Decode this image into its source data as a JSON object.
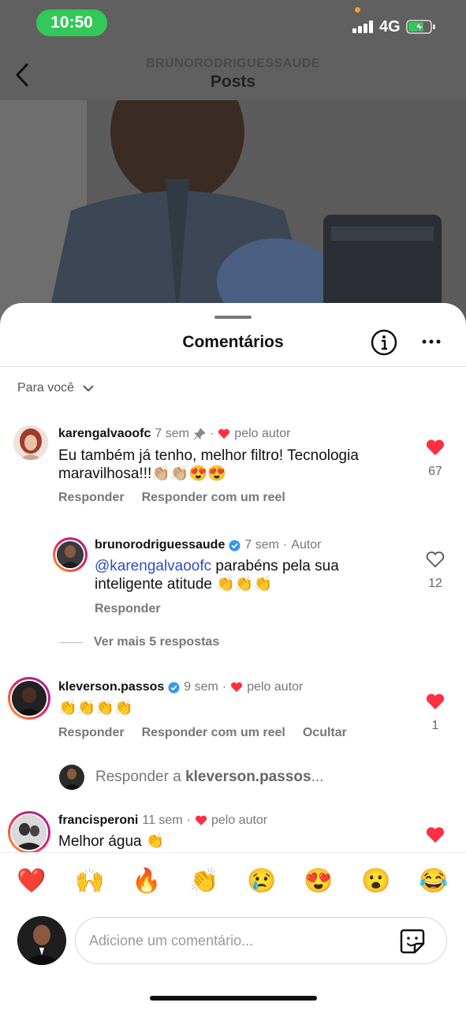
{
  "status": {
    "time": "10:50",
    "network": "4G"
  },
  "header": {
    "username": "BRUNORODRIGUESSAUDE",
    "title": "Posts"
  },
  "sheet": {
    "title": "Comentários",
    "sort_label": "Para você"
  },
  "comments": [
    {
      "username": "karengalvaoofc",
      "time": "7 sem",
      "liked_by_author": "pelo autor",
      "text": "Eu também já tenho, melhor filtro! Tecnologia maravilhosa!!!👏🏼👏🏼😍😍",
      "likes": "67",
      "actions": [
        "Responder",
        "Responder com um reel"
      ]
    },
    {
      "username": "brunorodriguessaude",
      "time": "7 sem",
      "author_badge": "Autor",
      "mention": "@karengalvaoofc",
      "text": " parabéns pela sua inteligente atitude 👏👏👏",
      "likes": "12",
      "actions": [
        "Responder"
      ]
    },
    {
      "username": "kleverson.passos",
      "time": "9 sem",
      "liked_by_author": "pelo autor",
      "text": "👏👏👏👏",
      "likes": "1",
      "actions": [
        "Responder",
        "Responder com um reel",
        "Ocultar"
      ]
    },
    {
      "username": "francisperoni",
      "time": "11 sem",
      "liked_by_author": "pelo autor",
      "text": "Melhor água 👏"
    }
  ],
  "more_replies": "Ver mais 5 respostas",
  "reply_to": {
    "prefix": "Responder a ",
    "user": "kleverson.passos",
    "suffix": "..."
  },
  "emojis": [
    "❤️",
    "🙌",
    "🔥",
    "👏",
    "😢",
    "😍",
    "😮",
    "😂"
  ],
  "composer": {
    "placeholder": "Adicione um comentário..."
  },
  "colors": {
    "like_red": "#ff3040",
    "verified_blue": "#3897f0",
    "status_green": "#34c759",
    "mention_blue": "#2d4ec0"
  }
}
